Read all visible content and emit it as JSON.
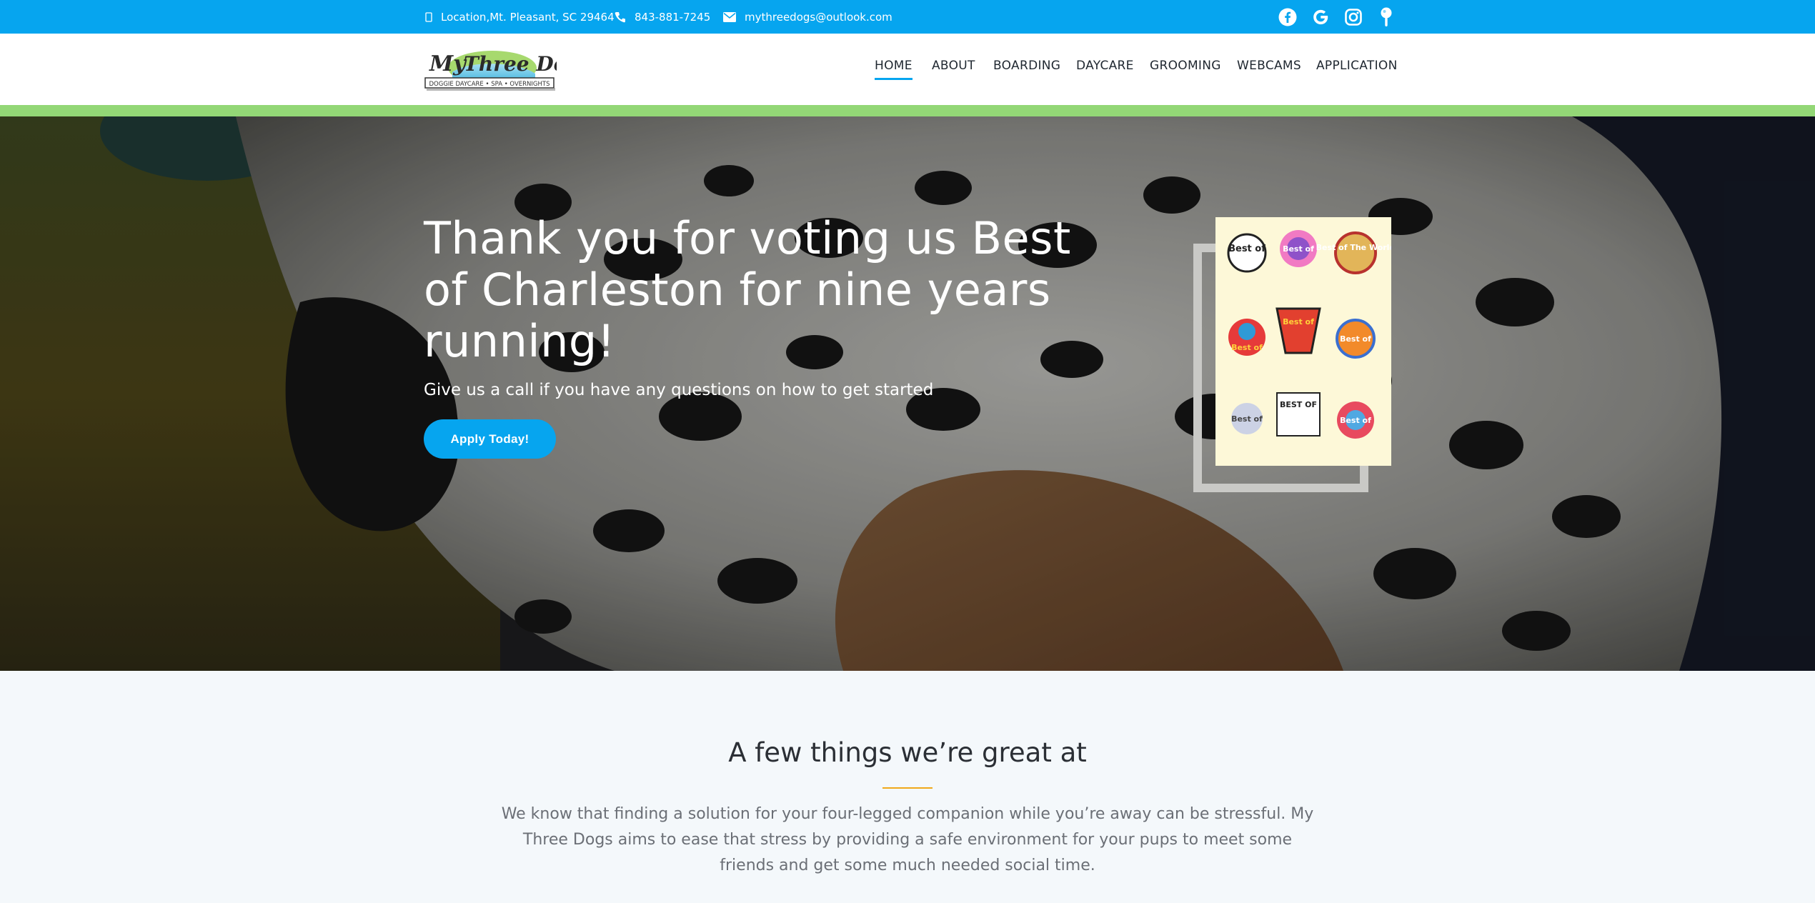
{
  "topbar": {
    "location": "Location,Mt. Pleasant, SC 29464",
    "phone": "843-881-7245",
    "email": "mythreedogs@outlook.com",
    "social_icons": [
      "facebook-icon",
      "google-icon",
      "instagram-icon",
      "map-pin-icon"
    ]
  },
  "brand": {
    "logo_text": "My Three Dogs",
    "logo_tagline": "DOGGIE DAYCARE • SPA • OVERNIGHTS"
  },
  "nav": {
    "items": [
      "HOME",
      "ABOUT",
      "BOARDING",
      "DAYCARE",
      "GROOMING",
      "WEBCAMS",
      "APPLICATION"
    ],
    "active": "HOME"
  },
  "hero": {
    "title": "Thank you for voting us Best of Charleston for nine years running!",
    "subtitle": "Give us a call if you have any questions on how to get started",
    "cta_label": "Apply Today!",
    "award_badges": [
      "Best of",
      "Best of",
      "Best of The World",
      "Best of",
      "Best of",
      "Best of",
      "Best of",
      "BEST OF",
      "Best of"
    ]
  },
  "intro": {
    "heading": "A few things we’re great at",
    "body": "We know that finding a solution for your four-legged companion while you’re away can be stressful. My Three Dogs aims to ease that stress by providing a safe environment for your pups to meet some friends and get some much needed social time."
  },
  "colors": {
    "topbar": "#06a5ef",
    "accent_green": "#93d776",
    "button": "#06a5ef",
    "heading_rule": "#f0a81a"
  }
}
